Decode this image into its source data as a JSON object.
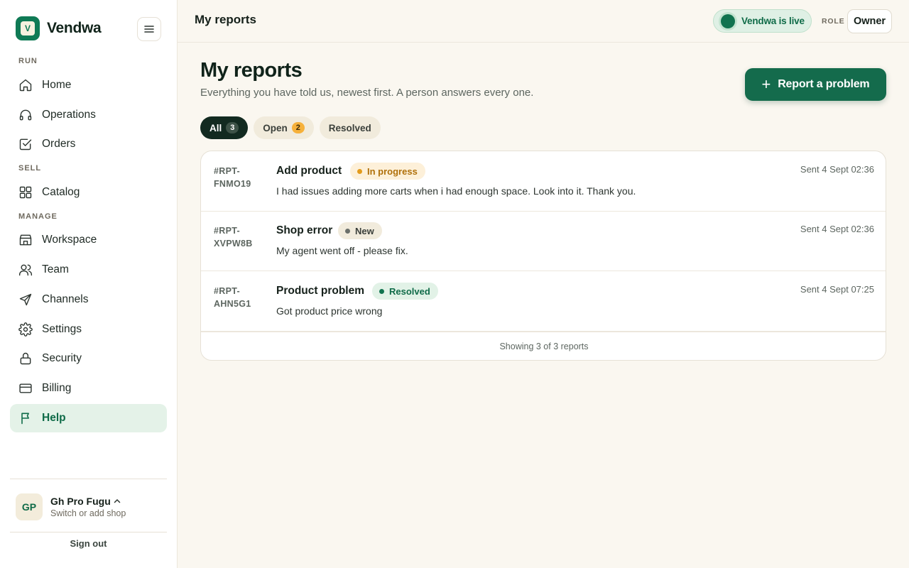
{
  "brand": {
    "name": "Vendwa",
    "logo_letter": "V"
  },
  "sidebar": {
    "sections": [
      {
        "label": "RUN"
      },
      {
        "label": "SELL"
      },
      {
        "label": "MANAGE"
      }
    ],
    "items": [
      {
        "label": "Home",
        "icon": "home-icon"
      },
      {
        "label": "Operations",
        "icon": "headphones-icon"
      },
      {
        "label": "Orders",
        "icon": "checkbox-icon"
      },
      {
        "label": "Catalog",
        "icon": "grid-icon"
      },
      {
        "label": "Workspace",
        "icon": "store-icon"
      },
      {
        "label": "Team",
        "icon": "users-icon"
      },
      {
        "label": "Channels",
        "icon": "send-icon"
      },
      {
        "label": "Settings",
        "icon": "gear-icon"
      },
      {
        "label": "Security",
        "icon": "lock-icon"
      },
      {
        "label": "Billing",
        "icon": "credit-card-icon"
      },
      {
        "label": "Help",
        "icon": "flag-icon",
        "active": true
      }
    ],
    "shop": {
      "initials": "GP",
      "name": "Gh Pro Fugu",
      "subtitle": "Switch or add shop"
    },
    "sign_out": "Sign out"
  },
  "header": {
    "title": "My reports",
    "live_status": "Vendwa is live",
    "role_label": "ROLE",
    "role_value": "Owner"
  },
  "main": {
    "title": "My reports",
    "subtitle": "Everything you have told us, newest first. A person answers every one.",
    "report_button": "Report a problem",
    "filters": [
      {
        "label": "All",
        "count": "3",
        "active": true
      },
      {
        "label": "Open",
        "count": "2"
      },
      {
        "label": "Resolved",
        "count": ""
      }
    ],
    "reports": [
      {
        "id": "#RPT-FNMO19",
        "title": "Add product",
        "status": "In progress",
        "description": "I had issues adding more carts when i had enough space. Look into it. Thank you.",
        "time": "Sent 4 Sept 02:36"
      },
      {
        "id": "#RPT-XVPW8B",
        "title": "Shop error",
        "status": "New",
        "description": "My agent went off - please fix.",
        "time": "Sent 4 Sept 02:36"
      },
      {
        "id": "#RPT-AHN5G1",
        "title": "Product problem",
        "status": "Resolved",
        "description": "Got product price wrong",
        "time": "Sent 4 Sept 07:25"
      }
    ],
    "footer": "Showing 3 of 3 reports"
  },
  "colors": {
    "brand_green": "#0f7a55",
    "background": "#faf7f0",
    "in_progress": "#e39b1c",
    "resolved": "#11734f"
  }
}
